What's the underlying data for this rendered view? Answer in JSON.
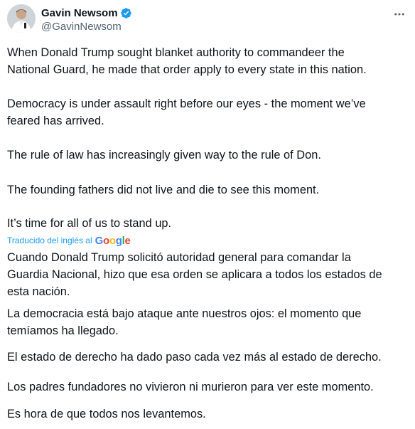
{
  "author": {
    "display_name": "Gavin Newsom",
    "handle": "@GavinNewsom",
    "verified_color": "#1d9bf0",
    "avatar_icon": "profile-photo"
  },
  "more_icon": "ellipsis-icon",
  "original_paragraphs": [
    [
      "When Donald Trump sought blanket authority to commandeer the",
      "National Guard, he made that order apply to every state in this nation."
    ],
    [
      "Democracy is under assault right before our eyes - the moment we’ve",
      "feared has arrived."
    ],
    [
      "The rule of law has increasingly given way to the rule of Don."
    ],
    [
      "The founding fathers did not live and die to see this moment."
    ],
    [
      "It’s time for all of us to stand up."
    ]
  ],
  "translation_label": "Traducido del inglés al",
  "google_brand": {
    "letters": [
      "G",
      "o",
      "o",
      "g",
      "l",
      "e"
    ],
    "colors": [
      "#4285f4",
      "#ea4335",
      "#fbbc05",
      "#4285f4",
      "#34a853",
      "#ea4335"
    ]
  },
  "translated_paragraphs": [
    [
      "Cuando Donald Trump solicitó autoridad general para comandar la",
      "Guardia Nacional, hizo que esa orden se aplicara a todos los estados de",
      "esta nación."
    ],
    [
      "La democracia está bajo ataque ante nuestros ojos: el momento que",
      "temíamos ha llegado."
    ],
    [
      "El estado de derecho ha dado paso cada vez más al estado de derecho."
    ],
    [
      "Los padres fundadores no vivieron ni murieron para ver este momento."
    ],
    [
      "Es hora de que todos nos levantemos."
    ]
  ]
}
